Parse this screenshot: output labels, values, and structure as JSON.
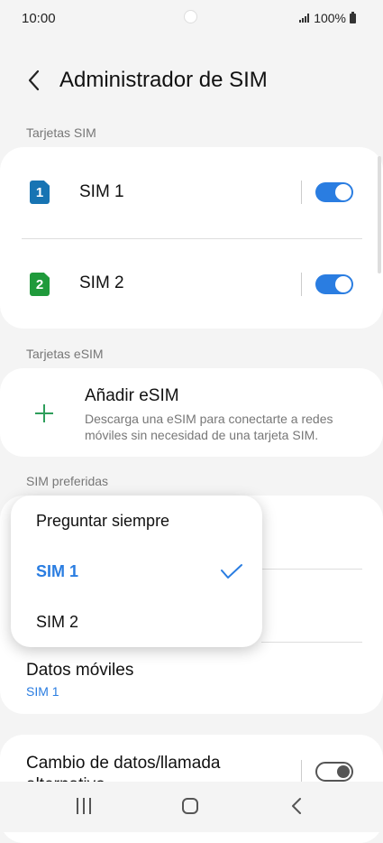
{
  "status": {
    "time": "10:00",
    "battery": "100%"
  },
  "header": {
    "title": "Administrador de SIM"
  },
  "sections": {
    "sim_cards": "Tarjetas SIM",
    "esim_cards": "Tarjetas eSIM",
    "preferred": "SIM preferidas"
  },
  "sims": [
    {
      "badge": "1",
      "name": "SIM 1",
      "color": "#1774b3",
      "enabled": true
    },
    {
      "badge": "2",
      "name": "SIM 2",
      "color": "#1f9a3b",
      "enabled": true
    }
  ],
  "esim": {
    "add_title": "Añadir eSIM",
    "add_desc": "Descarga una eSIM para conectarte a redes móviles sin necesidad de una tarjeta SIM."
  },
  "preferred": {
    "mobile_data_title": "Datos móviles",
    "mobile_data_value": "SIM 1"
  },
  "popup": {
    "items": [
      {
        "label": "Preguntar siempre",
        "selected": false
      },
      {
        "label": "SIM 1",
        "selected": true
      },
      {
        "label": "SIM 2",
        "selected": false
      }
    ]
  },
  "data_switch": {
    "title_line1": "Cambio de datos/llamada",
    "title_line2": "alternativo",
    "enabled": false
  },
  "colors": {
    "accent": "#2a7de1",
    "green": "#2e9e5b"
  }
}
